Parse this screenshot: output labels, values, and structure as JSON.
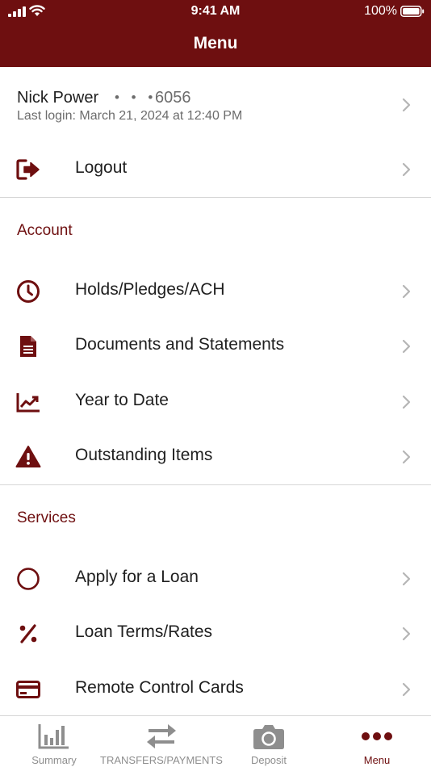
{
  "status_bar": {
    "time": "9:41 AM",
    "battery": "100%",
    "icons": [
      "signal-icon",
      "wifi-icon",
      "battery-icon"
    ]
  },
  "header": {
    "title": "Menu"
  },
  "profile": {
    "name": "Nick Power",
    "masked": "• • •",
    "account_suffix": "6056",
    "last_login": "Last login: March 21, 2024 at 12:40 PM"
  },
  "logout": {
    "label": "Logout",
    "icon": "logout-icon"
  },
  "sections": {
    "account": {
      "title": "Account",
      "items": [
        {
          "label": "Holds/Pledges/ACH",
          "icon": "clock-icon"
        },
        {
          "label": "Documents and Statements",
          "icon": "document-icon"
        },
        {
          "label": "Year to Date",
          "icon": "chart-line-icon"
        },
        {
          "label": "Outstanding Items",
          "icon": "warning-icon"
        }
      ]
    },
    "services": {
      "title": "Services",
      "items": [
        {
          "label": "Apply for a Loan",
          "icon": "circle-icon"
        },
        {
          "label": "Loan Terms/Rates",
          "icon": "percent-icon"
        },
        {
          "label": "Remote Control Cards",
          "icon": "credit-card-icon"
        }
      ]
    }
  },
  "tabs": [
    {
      "label": "Summary",
      "icon": "bar-chart-icon",
      "active": false
    },
    {
      "label": "TRANSFERS/PAYMENTS",
      "icon": "transfer-arrows-icon",
      "active": false
    },
    {
      "label": "Deposit",
      "icon": "camera-icon",
      "active": false
    },
    {
      "label": "Menu",
      "icon": "more-dots-icon",
      "active": true
    }
  ],
  "colors": {
    "brand": "#6e0f10",
    "text": "#1f1f1f",
    "muted": "#6c6c6c",
    "tab_inactive": "#8e8e8e",
    "divider": "#d6d6d6"
  }
}
